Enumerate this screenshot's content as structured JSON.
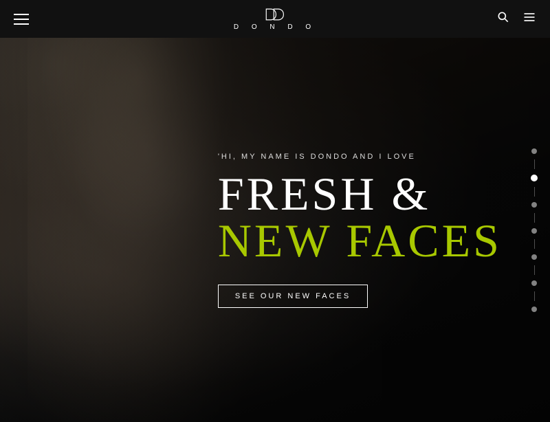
{
  "header": {
    "logo_text": "D O N D O",
    "logo_title": "Dondo"
  },
  "hero": {
    "subtitle": "'HI, MY NAME IS DONDO AND I LOVE",
    "title_line1": "FRESH &",
    "title_line2": "NEW FACES",
    "cta_label": "SEE OUR NEW FACES"
  },
  "dots": [
    {
      "label": "slide-1",
      "active": false
    },
    {
      "label": "slide-2",
      "active": true
    },
    {
      "label": "slide-3",
      "active": false
    },
    {
      "label": "slide-4",
      "active": false
    },
    {
      "label": "slide-5",
      "active": false
    },
    {
      "label": "slide-6",
      "active": false
    },
    {
      "label": "slide-7",
      "active": false
    }
  ]
}
